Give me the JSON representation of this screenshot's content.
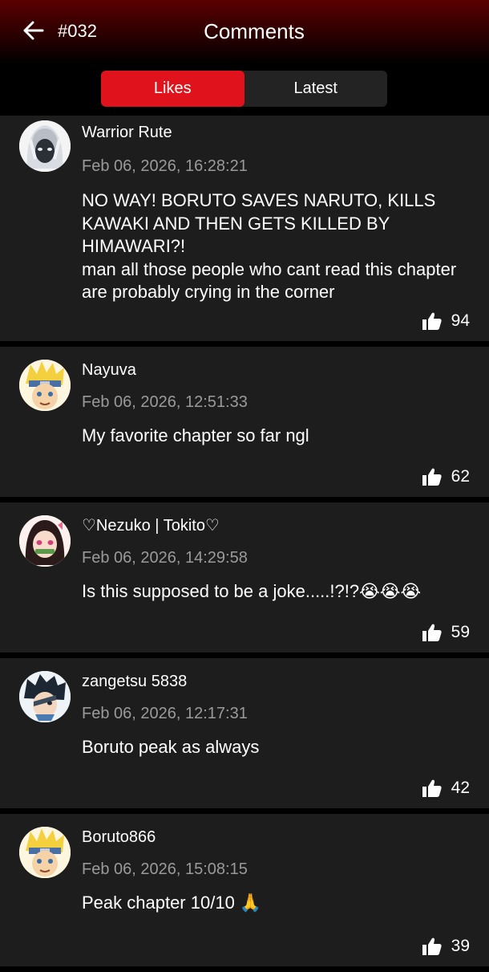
{
  "header": {
    "chapter": "#032",
    "title": "Comments"
  },
  "tabs": [
    {
      "label": "Likes",
      "active": true
    },
    {
      "label": "Latest",
      "active": false
    }
  ],
  "colors": {
    "accent": "#e0121b",
    "card": "#1d1d1d",
    "muted_text": "#9a9a9a"
  },
  "comments": [
    {
      "username": "Warrior Rute",
      "timestamp": "Feb 06, 2026, 16:28:21",
      "text": "NO WAY! BORUTO SAVES NARUTO, KILLS KAWAKI AND THEN GETS KILLED BY HIMAWARI?!\nman all those people who cant read this chapter are probably crying in the corner",
      "likes": "94",
      "avatar": "white-haired-character-avatar"
    },
    {
      "username": "Nayuva",
      "timestamp": "Feb 06, 2026, 12:51:33",
      "text": "My favorite chapter so far ngl",
      "likes": "62",
      "avatar": "blonde-ninja-avatar"
    },
    {
      "username": "♡Nezuko | Tokito♡",
      "timestamp": "Feb 06, 2026, 14:29:58",
      "text": "Is this supposed to be a joke.....!?!?😭😭😭",
      "likes": "59",
      "avatar": "nezuko-avatar"
    },
    {
      "username": "zangetsu 5838",
      "timestamp": "Feb 06, 2026, 12:17:31",
      "text": "Boruto peak as always",
      "likes": "42",
      "avatar": "dark-haired-ninja-avatar"
    },
    {
      "username": "Boruto866",
      "timestamp": "Feb 06, 2026, 15:08:15",
      "text": "Peak chapter 10/10 🙏",
      "likes": "39",
      "avatar": "blonde-ninja-avatar"
    }
  ]
}
